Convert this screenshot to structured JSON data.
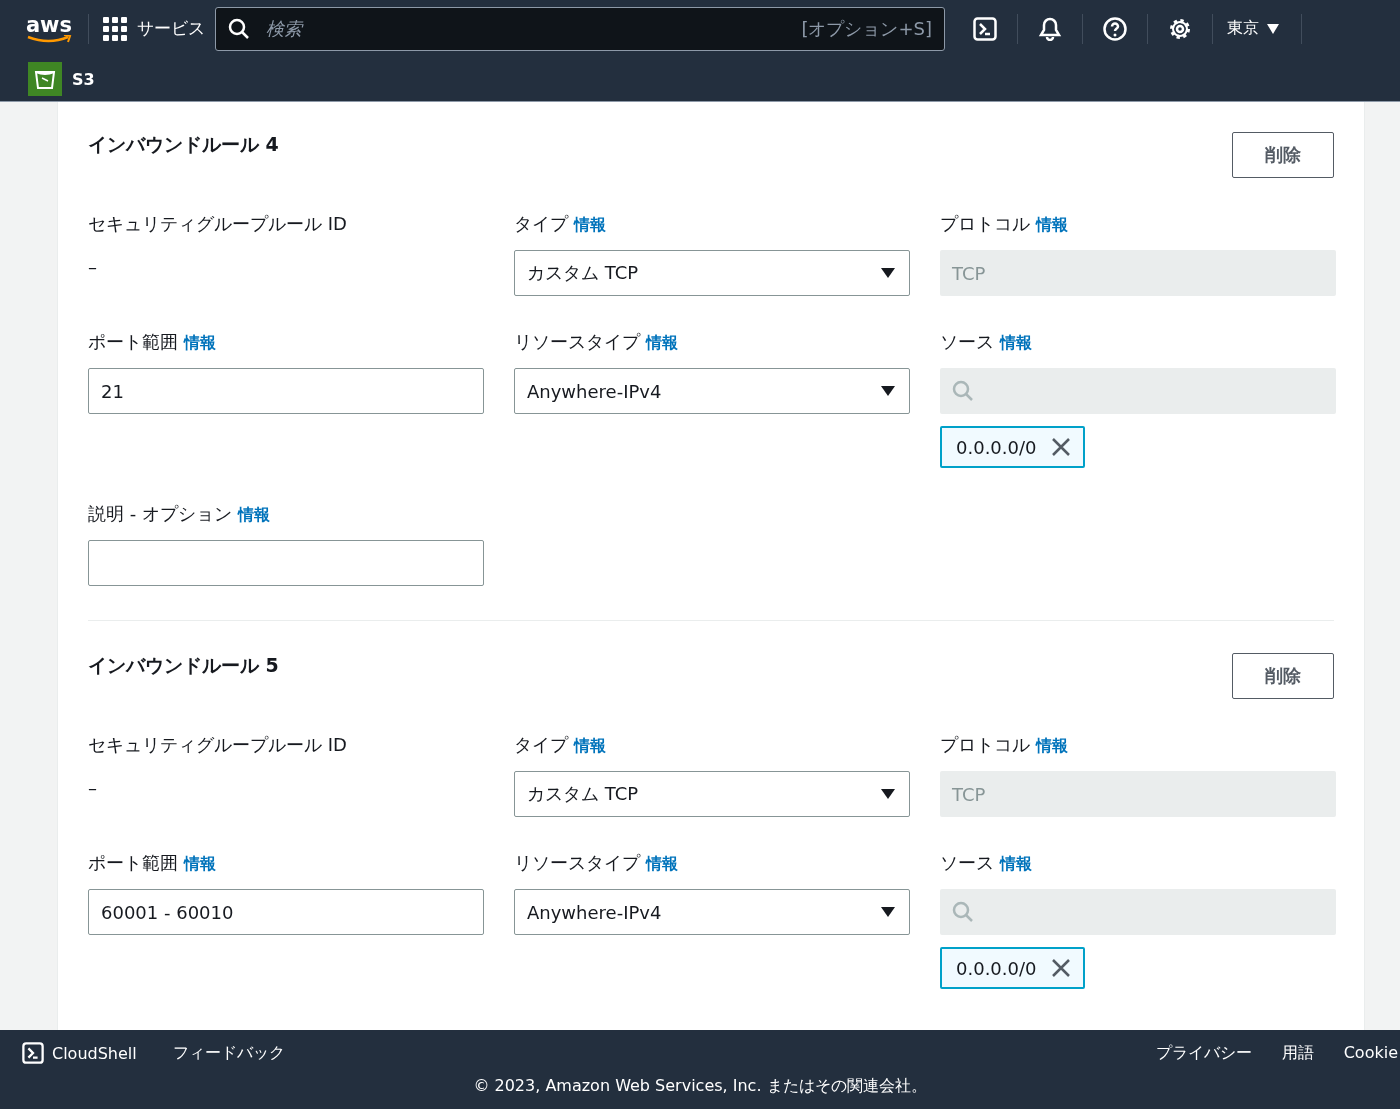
{
  "header": {
    "logo": "aws",
    "services": "サービス",
    "search_placeholder": "検索",
    "search_shortcut": "[オプション+S]",
    "region": "東京",
    "service_name": "S3"
  },
  "rules": [
    {
      "title": "インバウンドルール 4",
      "delete": "削除",
      "id_label": {
        "text": "セキュリティグループルール ID"
      },
      "id_value": "–",
      "type_label": {
        "text": "タイプ",
        "info": "情報"
      },
      "type_value": "カスタム TCP",
      "protocol_label": {
        "text": "プロトコル",
        "info": "情報"
      },
      "protocol_value": "TCP",
      "port_label": {
        "text": "ポート範囲",
        "info": "情報"
      },
      "port_value": "21",
      "resource_label": {
        "text": "リソースタイプ",
        "info": "情報"
      },
      "resource_value": "Anywhere-IPv4",
      "source_label": {
        "text": "ソース",
        "info": "情報"
      },
      "source_token": "0.0.0.0/0",
      "desc_label": {
        "text": "説明 - オプション",
        "info": "情報"
      }
    },
    {
      "title": "インバウンドルール 5",
      "delete": "削除",
      "id_label": {
        "text": "セキュリティグループルール ID"
      },
      "id_value": "–",
      "type_label": {
        "text": "タイプ",
        "info": "情報"
      },
      "type_value": "カスタム TCP",
      "protocol_label": {
        "text": "プロトコル",
        "info": "情報"
      },
      "protocol_value": "TCP",
      "port_label": {
        "text": "ポート範囲",
        "info": "情報"
      },
      "port_value": "60001 - 60010",
      "resource_label": {
        "text": "リソースタイプ",
        "info": "情報"
      },
      "resource_value": "Anywhere-IPv4",
      "source_label": {
        "text": "ソース",
        "info": "情報"
      },
      "source_token": "0.0.0.0/0"
    }
  ],
  "footer": {
    "cloudshell": "CloudShell",
    "feedback": "フィードバック",
    "links": [
      "プライバシー",
      "用語",
      "Cookie"
    ],
    "copyright": "© 2023, Amazon Web Services, Inc. またはその関連会社。"
  }
}
